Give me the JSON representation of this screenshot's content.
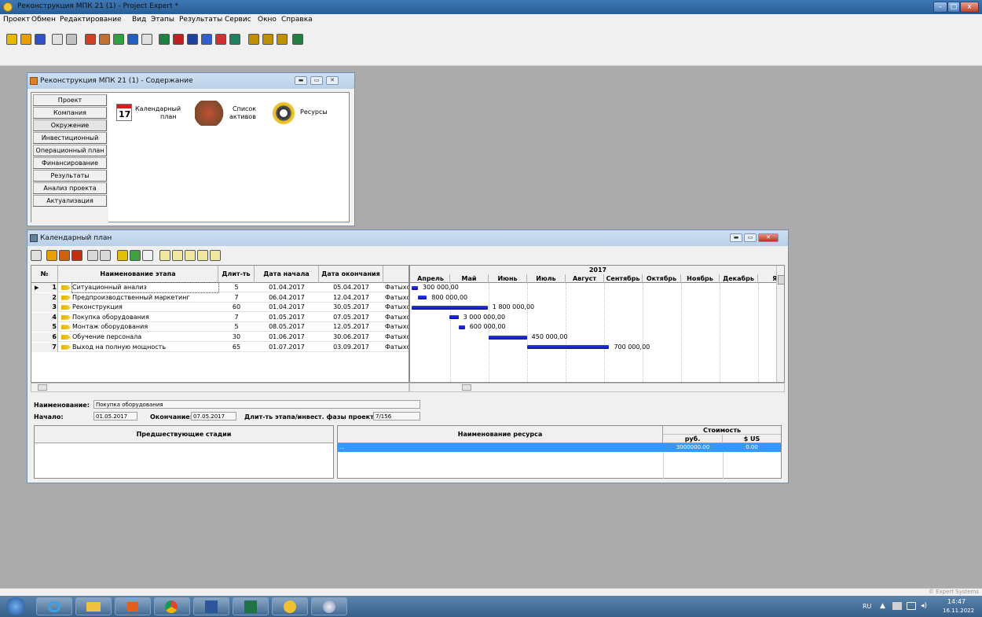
{
  "app": {
    "title": "Реконструкция МПК 21 (1) - Project Expert *"
  },
  "menu": [
    "Проект",
    "Обмен",
    "Редактирование",
    "Вид",
    "Этапы",
    "Результаты",
    "Сервис",
    "Окно",
    "Справка"
  ],
  "content_window": {
    "title": "Реконструкция МПК 21 (1) - Содержание",
    "nav": [
      "Проект",
      "Компания",
      "Окружение",
      "Инвестиционный план",
      "Операционный план",
      "Финансирование",
      "Результаты",
      "Анализ проекта",
      "Актуализация"
    ],
    "icons": {
      "calendar_day": "17",
      "calendar_label_1": "Календарный",
      "calendar_label_2": "план",
      "assets_label_1": "Список",
      "assets_label_2": "активов",
      "resources_label": "Ресурсы"
    }
  },
  "calendar_window": {
    "title": "Календарный план",
    "columns": [
      "№",
      "Наименование этапа",
      "Длит-ть",
      "Дата начала",
      "Дата окончания"
    ],
    "year": "2017",
    "months": [
      "Апрель",
      "Май",
      "Июнь",
      "Июль",
      "Август",
      "Сентябрь",
      "Октябрь",
      "Ноябрь",
      "Декабрь",
      "Ян"
    ],
    "rows": [
      {
        "n": "1",
        "name": "Ситуационный анализ",
        "dur": "5",
        "start": "01.04.2017",
        "end": "05.04.2017",
        "type": "Фатыхо",
        "cost": "300 000,00"
      },
      {
        "n": "2",
        "name": "Предпроизводственный маркетинг",
        "dur": "7",
        "start": "06.04.2017",
        "end": "12.04.2017",
        "type": "Фатыхо",
        "cost": "800 000,00"
      },
      {
        "n": "3",
        "name": "Реконструкция",
        "dur": "60",
        "start": "01.04.2017",
        "end": "30.05.2017",
        "type": "Фатыхо",
        "cost": "1 800 000,00"
      },
      {
        "n": "4",
        "name": "Покупка оборудования",
        "dur": "7",
        "start": "01.05.2017",
        "end": "07.05.2017",
        "type": "Фатыхо",
        "cost": "3 000 000,00"
      },
      {
        "n": "5",
        "name": "Монтаж оборудования",
        "dur": "5",
        "start": "08.05.2017",
        "end": "12.05.2017",
        "type": "Фатыхо",
        "cost": "600 000,00"
      },
      {
        "n": "6",
        "name": "Обучение персонала",
        "dur": "30",
        "start": "01.06.2017",
        "end": "30.06.2017",
        "type": "Фатыхо",
        "cost": "450 000,00"
      },
      {
        "n": "7",
        "name": "Выход на полную мощность",
        "dur": "65",
        "start": "01.07.2017",
        "end": "03.09.2017",
        "type": "Фатыхо",
        "cost": "700 000,00"
      }
    ],
    "detail": {
      "name_label": "Наименование:",
      "name_value": "Покупка оборудования",
      "start_label": "Начало:",
      "start_value": "01.05.2017",
      "end_label": "Окончание:",
      "end_value": "07.05.2017",
      "dur_label": "Длит-ть этапа/инвест. фазы проекта:",
      "dur_value": "7/156",
      "pred_header": "Предшествующие стадии",
      "res_header": "Наименование ресурса",
      "cost_header": "Стоимость",
      "rub": "руб.",
      "usd": "$ US",
      "res_row_rub": "3000000.00",
      "res_row_usd": "0.00"
    }
  },
  "status": {
    "brand": "© Expert Systems"
  },
  "tray": {
    "lang": "RU",
    "time": "14:47",
    "date": "16.11.2022"
  },
  "colors": {
    "bar": "#1520c8",
    "selection": "#3399ff",
    "title_gradient": "#2a5d96"
  }
}
